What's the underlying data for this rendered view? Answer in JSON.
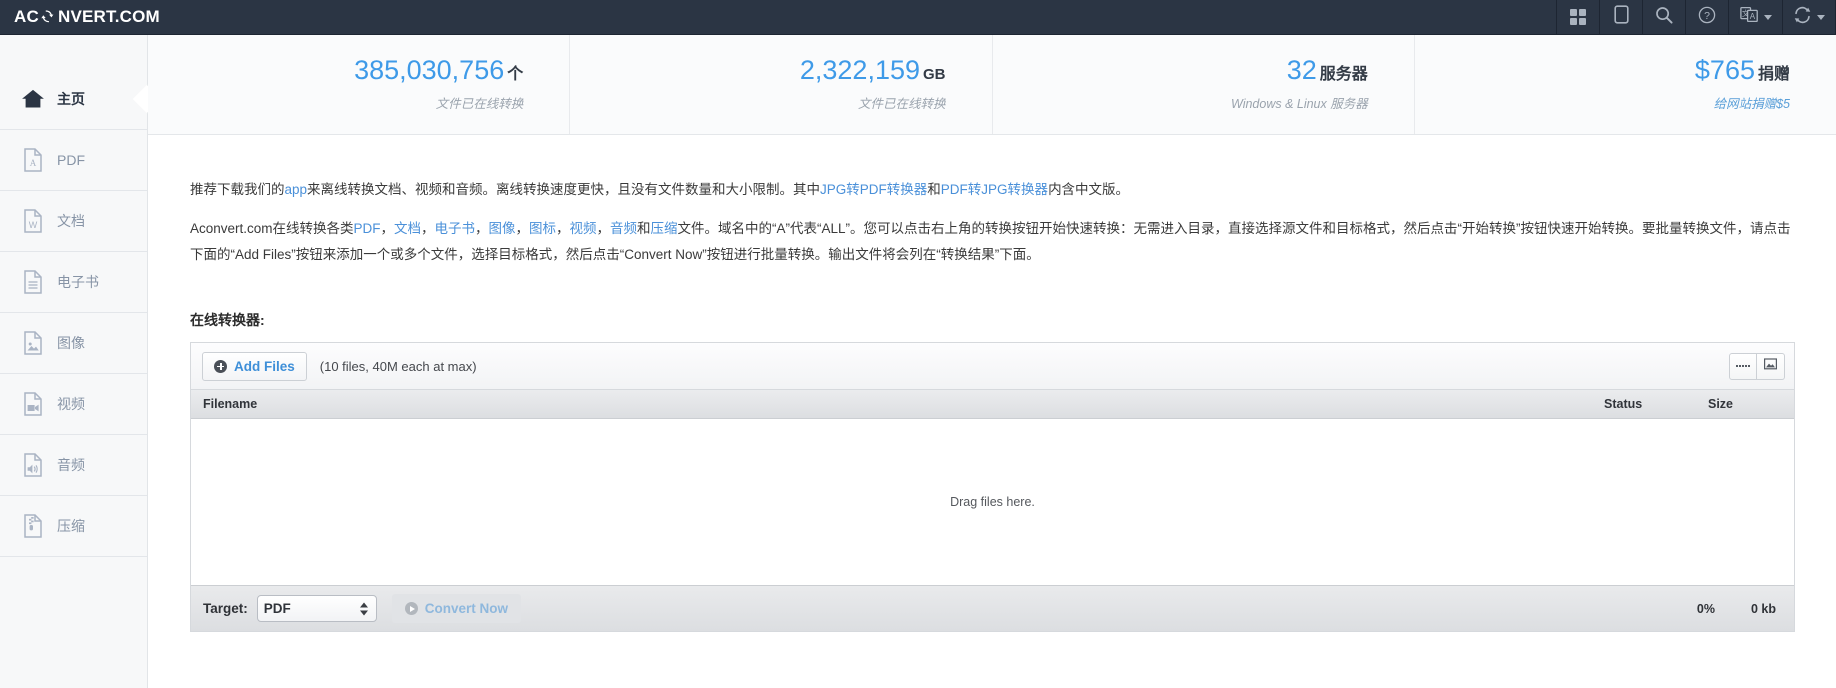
{
  "header": {
    "brand_left": "AC",
    "brand_right": "NVERT.COM",
    "logo_icon": "refresh-circular-arrows-icon",
    "icons": [
      {
        "name": "apps-grid-icon",
        "label": "Apps"
      },
      {
        "name": "mobile-device-icon",
        "label": "Mobile"
      },
      {
        "name": "search-icon",
        "label": "Search"
      },
      {
        "name": "help-question-icon",
        "label": "Help"
      },
      {
        "name": "language-translate-icon",
        "label": "Language"
      },
      {
        "name": "convert-refresh-icon",
        "label": "Convert"
      }
    ]
  },
  "sidebar": {
    "items": [
      {
        "label": "主页",
        "icon": "home-icon",
        "active": true
      },
      {
        "label": "PDF",
        "icon": "pdf-file-icon",
        "active": false
      },
      {
        "label": "文档",
        "icon": "word-document-icon",
        "active": false
      },
      {
        "label": "电子书",
        "icon": "ebook-file-icon",
        "active": false
      },
      {
        "label": "图像",
        "icon": "image-file-icon",
        "active": false
      },
      {
        "label": "视频",
        "icon": "video-file-icon",
        "active": false
      },
      {
        "label": "音频",
        "icon": "audio-file-icon",
        "active": false
      },
      {
        "label": "压缩",
        "icon": "archive-zip-file-icon",
        "active": false
      }
    ]
  },
  "stats": [
    {
      "number": "385,030,756",
      "unit": "个",
      "unit_cjk": true,
      "sub": "文件已在线转换",
      "sub_is_link": false
    },
    {
      "number": "2,322,159",
      "unit": "GB",
      "unit_cjk": false,
      "sub": "文件已在线转换",
      "sub_is_link": false
    },
    {
      "number": "32",
      "unit": "服务器",
      "unit_cjk": true,
      "sub": "Windows & Linux 服务器",
      "sub_is_link": false
    },
    {
      "number": "$765",
      "unit": "捐赠",
      "unit_cjk": true,
      "sub": "给网站捐赠$5",
      "sub_is_link": true
    }
  ],
  "intro": {
    "p1_a": "推荐下载我们的",
    "p1_link1": "app",
    "p1_b": "来离线转换文档、视频和音频。离线转换速度更快，且没有文件数量和大小限制。其中",
    "p1_link2": "JPG转PDF转换器",
    "p1_c": "和",
    "p1_link3": "PDF转JPG转换器",
    "p1_d": "内含中文版。",
    "p2_a": "Aconvert.com在线转换各类",
    "p2_link1": "PDF",
    "p2_s1": "，",
    "p2_link2": "文档",
    "p2_s2": "，",
    "p2_link3": "电子书",
    "p2_s3": "，",
    "p2_link4": "图像",
    "p2_s4": "，",
    "p2_link5": "图标",
    "p2_s5": "，",
    "p2_link6": "视频",
    "p2_s6": "，",
    "p2_link7": "音频",
    "p2_s7": "和",
    "p2_link8": "压缩",
    "p2_b": "文件。域名中的“A”代表“ALL”。您可以点击右上角的转换按钮开始快速转换：无需进入目录，直接选择源文件和目标格式，然后点击“开始转换”按钮快速开始转换。要批量转换文件，请点击下面的“Add Files”按钮来添加一个或多个文件，选择目标格式，然后点击“Convert Now”按钮进行批量转换。输出文件将会列在“转换结果”下面。"
  },
  "converter": {
    "section_title": "在线转换器:",
    "add_files_label": "Add Files",
    "add_files_icon": "plus-circle-icon",
    "limit_hint": "(10 files, 40M each at max)",
    "view_list_icon": "list-view-icon",
    "view_thumb_icon": "thumbnail-view-icon",
    "columns": {
      "filename": "Filename",
      "status": "Status",
      "size": "Size"
    },
    "drop_text": "Drag files here.",
    "rows": [],
    "target_label": "Target:",
    "target_value": "PDF",
    "target_options": [
      "PDF"
    ],
    "convert_label": "Convert Now",
    "convert_icon": "play-circle-icon",
    "convert_disabled": true,
    "progress_percent": "0%",
    "total_size": "0 kb"
  },
  "colors": {
    "topbar_bg": "#2b3544",
    "accent_blue": "#3e9ae8",
    "link_blue": "#4a90d9",
    "sidebar_bg": "#f7f8f9"
  }
}
